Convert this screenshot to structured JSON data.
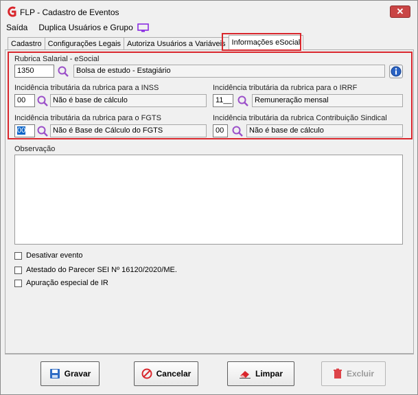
{
  "window": {
    "title": "FLP - Cadastro de Eventos",
    "close_label": "✕"
  },
  "menu": {
    "items": [
      "Saída",
      "Duplica Usuários e Grupo"
    ]
  },
  "tabs": [
    "Cadastro",
    "Configurações Legais",
    "Autoriza Usuários a Variáveis",
    "Informações eSocial"
  ],
  "active_tab": "Informações eSocial",
  "esocial": {
    "rubrica_label": "Rubrica Salarial - eSocial",
    "rubrica_code": "1350",
    "rubrica_desc": "Bolsa de estudo - Estagiário",
    "inss_label": "Incidência tributária da rubrica para a INSS",
    "inss_code": "00",
    "inss_desc": "Não é base de cálculo",
    "irrf_label": "Incidência tributária da rubrica para o IRRF",
    "irrf_code": "11__",
    "irrf_desc": "Remuneração mensal",
    "fgts_label": "Incidência tributária da rubrica para o FGTS",
    "fgts_code": "00",
    "fgts_desc": "Não é Base de Cálculo do FGTS",
    "sindical_label": "Incidência tributária da rubrica Contribuição Sindical",
    "sindical_code": "00",
    "sindical_desc": "Não é base de cálculo"
  },
  "observacao": {
    "label": "Observação",
    "value": ""
  },
  "checkboxes": [
    {
      "label": "Desativar evento",
      "checked": false
    },
    {
      "label": "Atestado do Parecer SEI Nº 16120/2020/ME.",
      "checked": false
    },
    {
      "label": "Apuração especial de IR",
      "checked": false
    }
  ],
  "buttons": {
    "gravar": "Gravar",
    "cancelar": "Cancelar",
    "limpar": "Limpar",
    "excluir": "Excluir"
  },
  "colors": {
    "highlight_red": "#d9262c",
    "search_purple": "#9b4fc9",
    "selection_blue": "#0a64c8"
  }
}
